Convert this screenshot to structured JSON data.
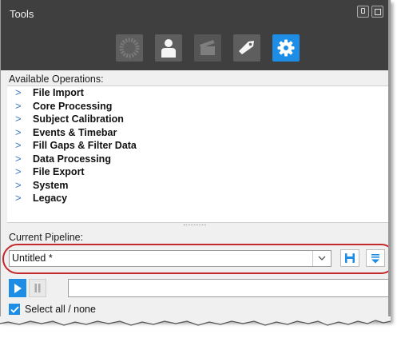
{
  "window": {
    "title": "Tools",
    "pin_icon": "pin-icon",
    "float_icon": "float-window-icon"
  },
  "toolbar": {
    "tools": [
      {
        "icon": "hardware-icon",
        "active": false
      },
      {
        "icon": "subject-icon",
        "active": false
      },
      {
        "icon": "clapperboard-icon",
        "active": false
      },
      {
        "icon": "label-tag-icon",
        "active": false
      },
      {
        "icon": "gear-icon",
        "active": true
      }
    ]
  },
  "operations": {
    "label": "Available Operations:",
    "chevron": ">",
    "items": [
      {
        "label": "File Import"
      },
      {
        "label": "Core Processing"
      },
      {
        "label": "Subject Calibration"
      },
      {
        "label": "Events & Timebar"
      },
      {
        "label": "Fill Gaps & Filter Data"
      },
      {
        "label": "Data Processing"
      },
      {
        "label": "File Export"
      },
      {
        "label": "System"
      },
      {
        "label": "Legacy"
      }
    ]
  },
  "pipeline": {
    "label": "Current Pipeline:",
    "value": "Untitled *",
    "dropdown_icon": "chevron-down-icon",
    "save_icon": "save-icon",
    "menu_icon": "pipeline-options-icon"
  },
  "playback": {
    "play_icon": "play-icon",
    "pause_icon": "pause-icon"
  },
  "select_all": {
    "label": "Select all / none",
    "checked": true
  },
  "colors": {
    "accent": "#1d8de6",
    "title_bar": "#3f3f3f",
    "highlight": "#c2282d",
    "chevron": "#3a78c2"
  }
}
